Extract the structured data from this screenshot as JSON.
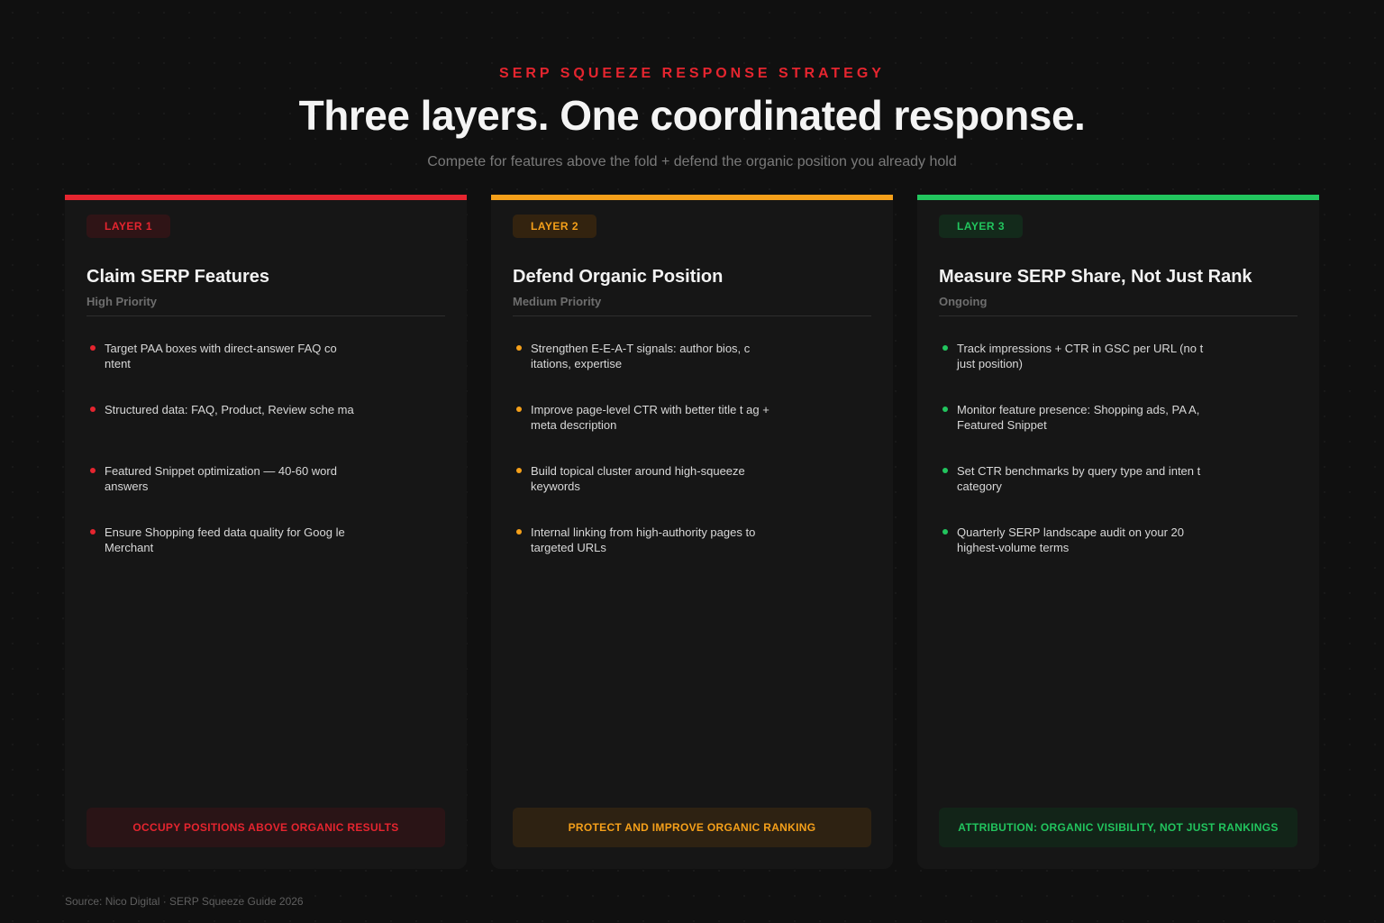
{
  "header": {
    "kicker": "SERP SQUEEZE RESPONSE STRATEGY",
    "title": "Three layers. One coordinated response.",
    "subtitle": "Compete for features above the fold + defend the organic position you already hold"
  },
  "colors": {
    "layer1": "#e5252f",
    "layer2": "#f5a01a",
    "layer3": "#22c55e"
  },
  "cards": [
    {
      "badge": "LAYER 1",
      "title": "Claim SERP Features",
      "priority": "High Priority",
      "items": [
        "Target PAA boxes with direct-answer FAQ co ntent",
        "Structured data: FAQ, Product, Review sche ma",
        "Featured Snippet optimization — 40-60 word answers",
        "Ensure Shopping feed data quality for Goog le Merchant"
      ],
      "footer": "OCCUPY POSITIONS ABOVE ORGANIC RESULTS"
    },
    {
      "badge": "LAYER 2",
      "title": "Defend Organic Position",
      "priority": "Medium Priority",
      "items": [
        "Strengthen E-E-A-T signals: author bios, c itations, expertise",
        "Improve page-level CTR with better title t ag + meta description",
        "Build topical cluster around high-squeeze keywords",
        "Internal linking from high-authority pages to targeted URLs"
      ],
      "footer": "PROTECT AND IMPROVE ORGANIC RANKING"
    },
    {
      "badge": "LAYER 3",
      "title": "Measure SERP Share, Not Just Rank",
      "priority": "Ongoing",
      "items": [
        "Track impressions + CTR in GSC per URL (no t just position)",
        "Monitor feature presence: Shopping ads, PA A, Featured Snippet",
        "Set CTR benchmarks by query type and inten t category",
        "Quarterly SERP landscape audit on your 20 highest-volume terms"
      ],
      "footer": "ATTRIBUTION: ORGANIC VISIBILITY, NOT JUST RANKINGS"
    }
  ],
  "source": "Source: Nico Digital · SERP Squeeze Guide 2026"
}
